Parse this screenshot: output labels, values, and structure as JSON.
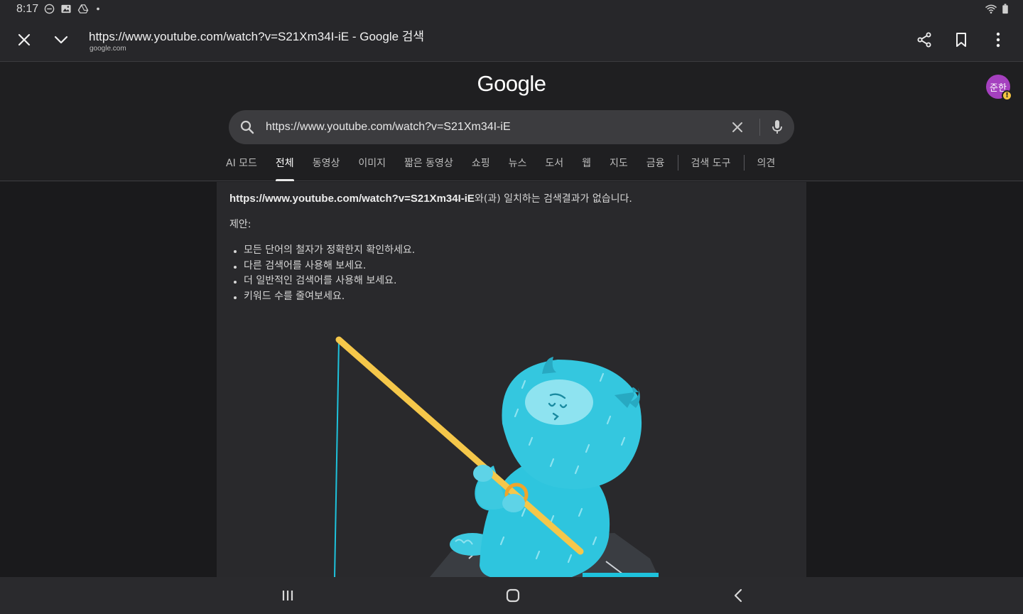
{
  "status_bar": {
    "time": "8:17",
    "icons": [
      "do-not-disturb-icon",
      "image-icon",
      "drive-icon",
      "dot-icon"
    ],
    "right_icons": [
      "wifi-icon",
      "battery-icon"
    ]
  },
  "top_bar": {
    "title": "https://www.youtube.com/watch?v=S21Xm34I-iE - Google 검색",
    "domain": "google.com",
    "icons": [
      "close-icon",
      "chevron-down-icon",
      "share-icon",
      "bookmark-icon",
      "more-vert-icon"
    ]
  },
  "header": {
    "logo": "Google",
    "avatar_text": "준한",
    "avatar_badge": "!",
    "avatar_color": "#a540bf"
  },
  "search": {
    "query": "https://www.youtube.com/watch?v=S21Xm34I-iE"
  },
  "tabs": [
    {
      "label": "AI 모드",
      "active": false
    },
    {
      "label": "전체",
      "active": true
    },
    {
      "label": "동영상",
      "active": false
    },
    {
      "label": "이미지",
      "active": false
    },
    {
      "label": "짧은 동영상",
      "active": false
    },
    {
      "label": "쇼핑",
      "active": false
    },
    {
      "label": "뉴스",
      "active": false
    },
    {
      "label": "도서",
      "active": false
    },
    {
      "label": "웹",
      "active": false
    },
    {
      "label": "지도",
      "active": false
    },
    {
      "label": "금융",
      "active": false
    }
  ],
  "tools_tab": "검색 도구",
  "feedback_tab": "의견",
  "results": {
    "query_bold": "https://www.youtube.com/watch?v=S21Xm34I-iE",
    "no_results_suffix": "와(과) 일치하는 검색결과가 없습니다.",
    "suggestions_label": "제안:",
    "suggestions": [
      "모든 단어의 철자가 정확한지 확인하세요.",
      "다른 검색어를 사용해 보세요.",
      "더 일반적인 검색어를 사용해 보세요.",
      "키워드 수를 줄여보세요."
    ]
  },
  "nav_bar": {
    "icons": [
      "recent-apps-icon",
      "home-icon",
      "back-icon"
    ]
  },
  "colors": {
    "accent_cyan": "#1ec2dc",
    "rod_yellow": "#f5c74a",
    "content_bg": "#29292c"
  }
}
